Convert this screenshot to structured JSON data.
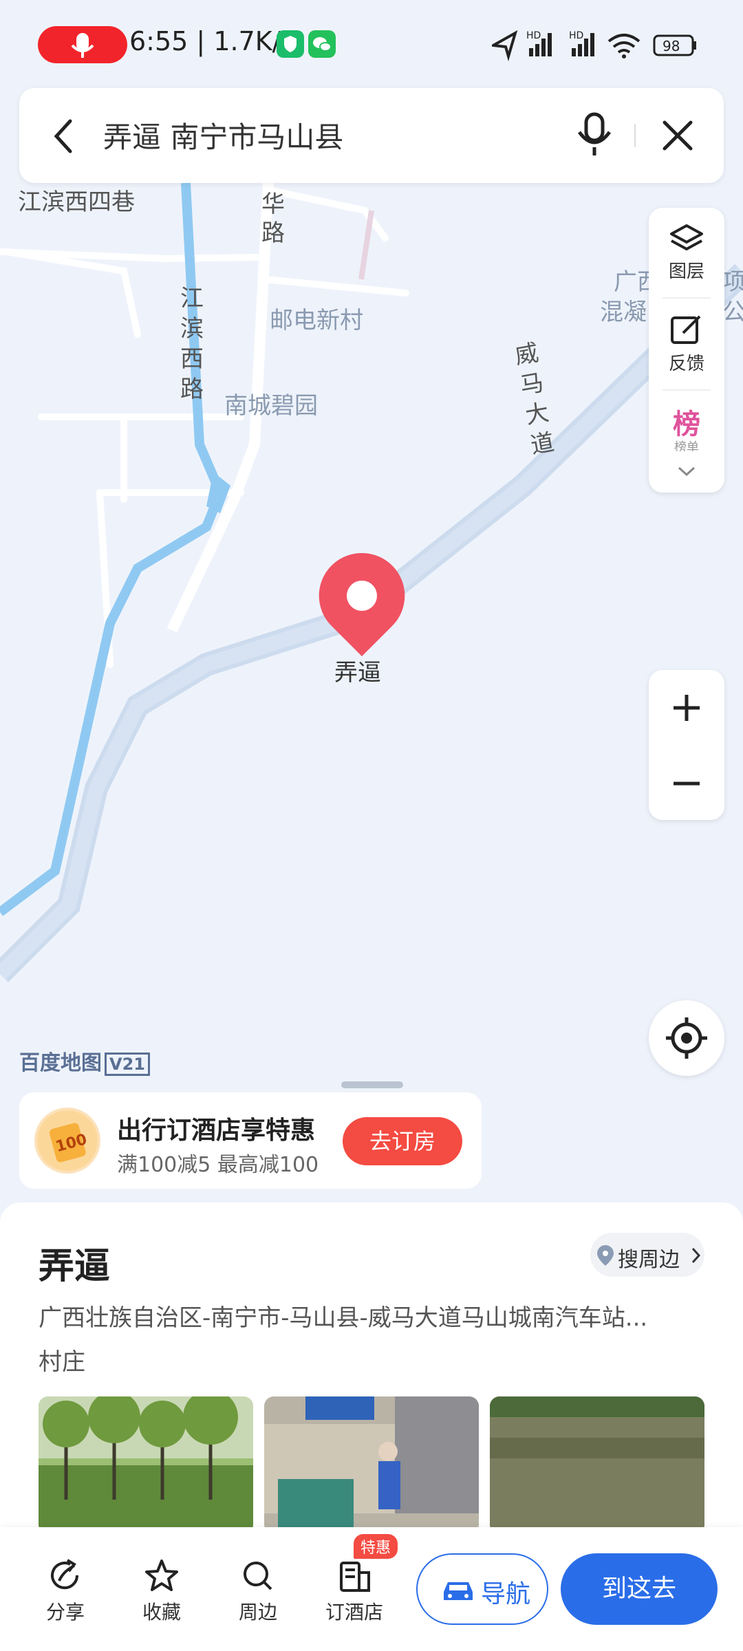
{
  "status_bar": {
    "time": "6:55",
    "speed": "1.7K/s",
    "battery": "98",
    "network_labels": [
      "HD",
      "HD"
    ]
  },
  "search": {
    "query": "弄逼 南宁市马山县"
  },
  "map": {
    "labels": {
      "jiangbin_xisi": "江滨西四巷",
      "hua_road": "华路",
      "youdian": "邮电新村",
      "jiangbin_xilu": "江滨西路",
      "nancheng": "南城碧园",
      "weima": "威马大道",
      "guangxi_a": "广西",
      "guangxi_b": "混凝",
      "far_a": "项",
      "far_b": "公"
    },
    "pin_label": "弄逼",
    "logo_text": "百度地图",
    "logo_version": "V21"
  },
  "tools": {
    "layers": "图层",
    "feedback": "反馈",
    "rank": "榜",
    "rank_sub": "榜单"
  },
  "promo": {
    "title": "出行订酒店享特惠",
    "subtitle": "满100减5 最高减100",
    "button": "去订房",
    "coupon_value": "100"
  },
  "place": {
    "name": "弄逼",
    "nearby": "搜周边",
    "address": "广西壮族自治区-南宁市-马山县-威马大道马山城南汽车站...",
    "category": "村庄"
  },
  "bottom": {
    "share": "分享",
    "favorite": "收藏",
    "around": "周边",
    "hotel": "订酒店",
    "hotel_badge": "特惠",
    "navigate": "导航",
    "go": "到这去"
  },
  "colors": {
    "accent_blue": "#2a6de8",
    "pin_red": "#f05262",
    "promo_red": "#f44b42",
    "record_red": "#f2242b"
  }
}
